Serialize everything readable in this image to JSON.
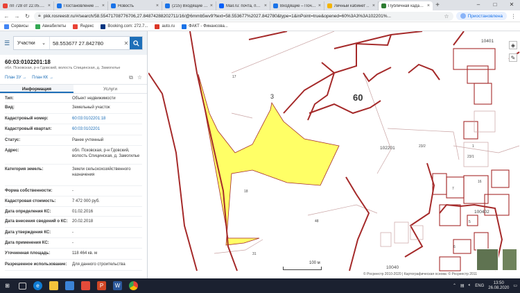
{
  "browser": {
    "tabs": [
      {
        "label": "пп 728 от 22.05.20..",
        "color": "#e94235"
      },
      {
        "label": "Постановление Пр..",
        "color": "#1a73e8"
      },
      {
        "label": "Новость",
        "color": "#1a73e8"
      },
      {
        "label": "(215) Входящие – П..",
        "color": "#1a73e8"
      },
      {
        "label": "Mail.ru: почта, поис..",
        "color": "#005ff9"
      },
      {
        "label": "Входящие – Почта ..",
        "color": "#1a73e8"
      },
      {
        "label": "Личный кабинет ..",
        "color": "#f4b400"
      },
      {
        "label": "Публичная кадаст..",
        "color": "#2e7d32"
      }
    ],
    "new_tab_symbol": "+",
    "window_controls": [
      "–",
      "□",
      "✕"
    ],
    "address": "pkk.rosreestr.ru/#/search/58.55471708776706,27.84874288202711/16/@6mmb5wv9?text=58.553677%2027.842780&type=1&inPoint=true&opened=60%3A3%3A102201%...",
    "profile_label": "Приостановлена",
    "bookmarks": [
      {
        "label": "Сервисы",
        "color": "#4285f4"
      },
      {
        "label": "Авиабилеты",
        "color": "#34a853"
      },
      {
        "label": "Яндекс",
        "color": "#e94235"
      },
      {
        "label": "Booking.com: 272.7...",
        "color": "#003580"
      },
      {
        "label": "auto.ru",
        "color": "#db3727"
      },
      {
        "label": "ФАКТ - Финансова...",
        "color": "#1a73e8"
      }
    ]
  },
  "panel": {
    "search_type": "Участки",
    "search_value": "58.553677 27.842780",
    "object_number": "60:03:0102201:18",
    "object_address": "обл. Псковская, р-н Гдовский, волость Спицинская, д. Замогилье",
    "plan_zu": "План ЗУ →",
    "plan_kk": "План КК →",
    "tab_info": "Информация",
    "tab_services": "Услуги",
    "props": [
      {
        "k": "Тип:",
        "v": "Объект недвижимости",
        "link": false,
        "h": 13
      },
      {
        "k": "Вид:",
        "v": "Земельный участок",
        "link": false,
        "h": 16
      },
      {
        "k": "Кадастровый номер:",
        "v": "60:03:0102201:18",
        "link": true,
        "h": 15
      },
      {
        "k": "Кадастровый квартал:",
        "v": "60:03:0102201",
        "link": true,
        "h": 16
      },
      {
        "k": "Статус:",
        "v": "Ранее учтенный",
        "link": false,
        "h": 15
      },
      {
        "k": "Адрес:",
        "v": "обл. Псковская, р-н Гдовский, волость Спицинская, д. Замогилье",
        "link": false,
        "h": 27
      },
      {
        "k": "Категория земель:",
        "v": "Земли сельскохозяйственного назначения",
        "link": false,
        "h": 31
      },
      {
        "k": "Форма собственности:",
        "v": "-",
        "link": false,
        "h": 15
      },
      {
        "k": "Кадастровая стоимость:",
        "v": "7 472 000 руб.",
        "link": false,
        "h": 15
      },
      {
        "k": "Дата определения КС:",
        "v": "01.02.2016",
        "link": false,
        "h": 14
      },
      {
        "k": "Дата внесения сведений о КС:",
        "v": "20.02.2018",
        "link": false,
        "h": 16
      },
      {
        "k": "Дата утверждения КС:",
        "v": "-",
        "link": false,
        "h": 15
      },
      {
        "k": "Дата применения КС:",
        "v": "-",
        "link": false,
        "h": 15
      },
      {
        "k": "Уточненная площадь:",
        "v": "118 464 кв. м",
        "link": false,
        "h": 16
      },
      {
        "k": "Разрешенное использование:",
        "v": "Для данного строительства",
        "link": false,
        "h": 16
      }
    ]
  },
  "map": {
    "labels": {
      "big60": "60",
      "n3": "3",
      "n102201": "102201",
      "n100402": "100402",
      "n10040": "10040",
      "n10401": "10401",
      "n17": "17",
      "n18": "18",
      "n48": "48",
      "n31": "31",
      "n23_2": "23/2",
      "n23_1": "23/1",
      "n1": "1",
      "n16": "16",
      "n7": "7",
      "n5": "5",
      "n6": "6"
    },
    "scale_label": "100 м",
    "copyright": "© Росреестр 2010-2020 | Картографическая основа: © Росреестр 2011",
    "parcel_color": "#ffff66",
    "boundary_color": "#a52a2a"
  },
  "taskbar": {
    "lang": "ENG",
    "time": "13:50",
    "date": "26.08.2020"
  }
}
